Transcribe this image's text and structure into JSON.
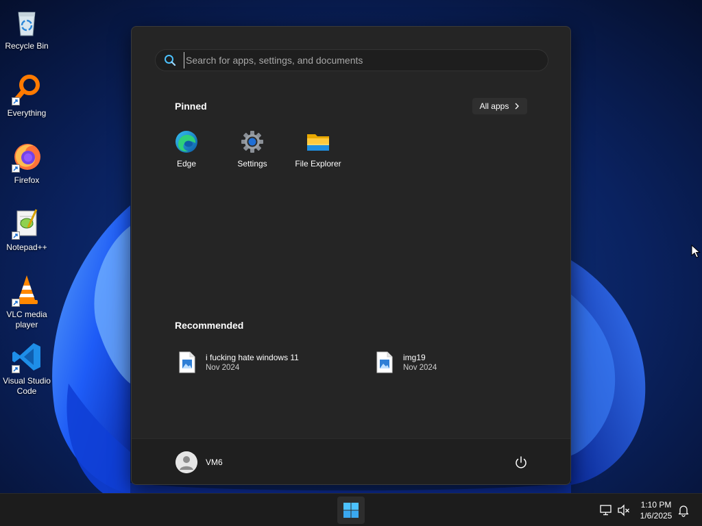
{
  "desktop": {
    "icons": [
      {
        "label": "Recycle Bin",
        "icon": "recycle-bin-icon"
      },
      {
        "label": "Everything",
        "icon": "everything-search-icon"
      },
      {
        "label": "Firefox",
        "icon": "firefox-icon"
      },
      {
        "label": "Notepad++",
        "icon": "notepad-plus-plus-icon"
      },
      {
        "label": "VLC media player",
        "icon": "vlc-cone-icon"
      },
      {
        "label": "Visual Studio Code",
        "icon": "vscode-icon"
      }
    ]
  },
  "start_menu": {
    "search": {
      "placeholder": "Search for apps, settings, and documents",
      "value": ""
    },
    "pinned": {
      "title": "Pinned",
      "all_apps_label": "All apps",
      "apps": [
        {
          "label": "Edge",
          "icon": "edge-icon"
        },
        {
          "label": "Settings",
          "icon": "settings-gear-icon"
        },
        {
          "label": "File Explorer",
          "icon": "folder-icon"
        }
      ]
    },
    "recommended": {
      "title": "Recommended",
      "items": [
        {
          "name": "i fucking hate windows 11",
          "date": "Nov 2024",
          "icon": "image-file-icon"
        },
        {
          "name": "img19",
          "date": "Nov 2024",
          "icon": "image-file-icon"
        }
      ]
    },
    "footer": {
      "user_name": "VM6",
      "power_icon": "power-icon"
    }
  },
  "taskbar": {
    "clock": {
      "time": "1:10 PM",
      "date": "1/6/2025"
    },
    "tray_icons": [
      "network-icon",
      "volume-muted-icon",
      "notification-bell-icon"
    ]
  },
  "colors": {
    "menu_bg": "#252525",
    "taskbar_bg": "#1c1c1c",
    "accent_blue": "#4cc2ff"
  }
}
